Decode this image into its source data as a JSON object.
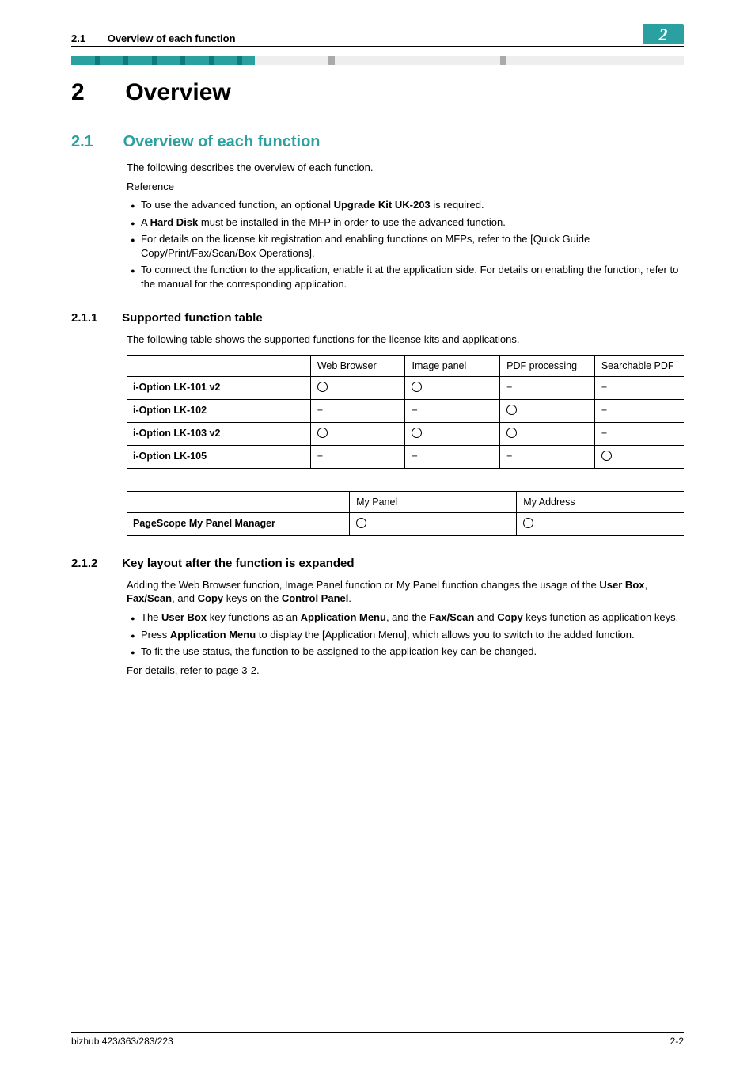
{
  "header": {
    "section_num": "2.1",
    "section_title": "Overview of each function",
    "chapter_badge": "2"
  },
  "chapter": {
    "num": "2",
    "title": "Overview"
  },
  "s21": {
    "num": "2.1",
    "title": "Overview of each function",
    "intro": "The following describes the overview of each function.",
    "reference_label": "Reference",
    "bullets": [
      {
        "pre": "To use the advanced function, an optional ",
        "b1": "Upgrade Kit UK-203",
        "post": " is required."
      },
      {
        "pre": "A ",
        "b1": "Hard Disk",
        "post": " must be installed in the MFP in order to use the advanced function."
      },
      {
        "pre": "For details on the license kit registration and enabling functions on MFPs, refer to the [Quick Guide Copy/Print/Fax/Scan/Box Operations].",
        "b1": "",
        "post": ""
      },
      {
        "pre": "To connect the function to the application, enable it at the application side. For details on enabling the function, refer to the manual for the corresponding application.",
        "b1": "",
        "post": ""
      }
    ]
  },
  "s211": {
    "num": "2.1.1",
    "title": "Supported function table",
    "intro": "The following table shows the supported functions for the license kits and applications.",
    "table1": {
      "headers": [
        "",
        "Web Browser",
        "Image panel",
        "PDF processing",
        "Searchable PDF"
      ],
      "rows": [
        {
          "label": "i-Option LK-101 v2",
          "cells": [
            "o",
            "o",
            "-",
            "-"
          ]
        },
        {
          "label": "i-Option LK-102",
          "cells": [
            "-",
            "-",
            "o",
            "-"
          ]
        },
        {
          "label": "i-Option LK-103 v2",
          "cells": [
            "o",
            "o",
            "o",
            "-"
          ]
        },
        {
          "label": "i-Option LK-105",
          "cells": [
            "-",
            "-",
            "-",
            "o"
          ]
        }
      ]
    },
    "table2": {
      "headers": [
        "",
        "My Panel",
        "My Address"
      ],
      "rows": [
        {
          "label": "PageScope My Panel Manager",
          "cells": [
            "o",
            "o"
          ]
        }
      ]
    }
  },
  "s212": {
    "num": "2.1.2",
    "title": "Key layout after the function is expanded",
    "intro": {
      "t1": "Adding the Web Browser function, Image Panel function or My Panel function changes the usage of the ",
      "b1": "User Box",
      "t2": ", ",
      "b2": "Fax/Scan",
      "t3": ", and ",
      "b3": "Copy",
      "t4": " keys on the ",
      "b4": "Control Panel",
      "t5": "."
    },
    "bullets": [
      {
        "t1": "The ",
        "b1": "User Box",
        "t2": " key functions as an ",
        "b2": "Application Menu",
        "t3": ", and the ",
        "b3": "Fax/Scan",
        "t4": " and ",
        "b4": "Copy",
        "t5": " keys function as application keys."
      },
      {
        "t1": "Press ",
        "b1": "Application Menu",
        "t2": " to display the [Application Menu], which allows you to switch to the added function.",
        "b2": "",
        "t3": "",
        "b3": "",
        "t4": "",
        "b4": "",
        "t5": ""
      },
      {
        "t1": "To fit the use status, the function to be assigned to the application key can be changed.",
        "b1": "",
        "t2": "",
        "b2": "",
        "t3": "",
        "b3": "",
        "t4": "",
        "b4": "",
        "t5": ""
      }
    ],
    "outro": "For details, refer to page 3-2."
  },
  "footer": {
    "left": "bizhub 423/363/283/223",
    "right": "2-2"
  }
}
